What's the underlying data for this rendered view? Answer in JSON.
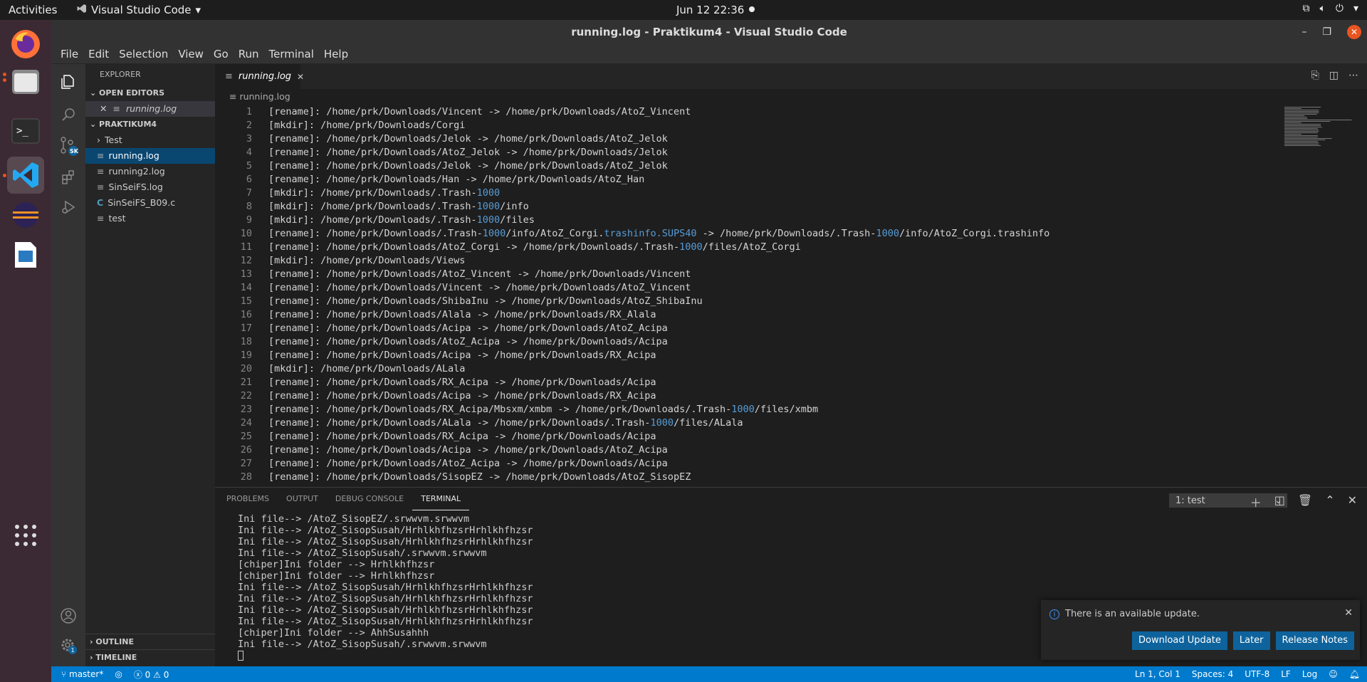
{
  "topbar": {
    "activities": "Activities",
    "app_menu": "Visual Studio Code",
    "clock": "Jun 12  22:36"
  },
  "window": {
    "title": "running.log - Praktikum4 - Visual Studio Code"
  },
  "menu": [
    "File",
    "Edit",
    "Selection",
    "View",
    "Go",
    "Run",
    "Terminal",
    "Help"
  ],
  "sidebar": {
    "title": "EXPLORER",
    "open_editors_label": "OPEN EDITORS",
    "open_editor_file": "running.log",
    "project_label": "PRAKTIKUM4",
    "files": [
      {
        "name": "Test",
        "type": "folder"
      },
      {
        "name": "running.log",
        "type": "log"
      },
      {
        "name": "running2.log",
        "type": "log"
      },
      {
        "name": "SinSeiFS.log",
        "type": "log"
      },
      {
        "name": "SinSeiFS_B09.c",
        "type": "c"
      },
      {
        "name": "test",
        "type": "file"
      }
    ],
    "outline_label": "OUTLINE",
    "timeline_label": "TIMELINE"
  },
  "editor": {
    "tab_label": "running.log",
    "breadcrumb": "running.log",
    "lines": [
      "[rename]: /home/prk/Downloads/Vincent -> /home/prk/Downloads/AtoZ_Vincent",
      "[mkdir]: /home/prk/Downloads/Corgi",
      "[rename]: /home/prk/Downloads/Jelok -> /home/prk/Downloads/AtoZ_Jelok",
      "[rename]: /home/prk/Downloads/AtoZ_Jelok -> /home/prk/Downloads/Jelok",
      "[rename]: /home/prk/Downloads/Jelok -> /home/prk/Downloads/AtoZ_Jelok",
      "[rename]: /home/prk/Downloads/Han -> /home/prk/Downloads/AtoZ_Han",
      "[mkdir]: /home/prk/Downloads/.Trash-1000",
      "[mkdir]: /home/prk/Downloads/.Trash-1000/info",
      "[mkdir]: /home/prk/Downloads/.Trash-1000/files",
      "[rename]: /home/prk/Downloads/.Trash-1000/info/AtoZ_Corgi.trashinfo.SUPS40 -> /home/prk/Downloads/.Trash-1000/info/AtoZ_Corgi.trashinfo",
      "[rename]: /home/prk/Downloads/AtoZ_Corgi -> /home/prk/Downloads/.Trash-1000/files/AtoZ_Corgi",
      "[mkdir]: /home/prk/Downloads/Views",
      "[rename]: /home/prk/Downloads/AtoZ_Vincent -> /home/prk/Downloads/Vincent",
      "[rename]: /home/prk/Downloads/Vincent -> /home/prk/Downloads/AtoZ_Vincent",
      "[rename]: /home/prk/Downloads/ShibaInu -> /home/prk/Downloads/AtoZ_ShibaInu",
      "[rename]: /home/prk/Downloads/Alala -> /home/prk/Downloads/RX_Alala",
      "[rename]: /home/prk/Downloads/Acipa -> /home/prk/Downloads/AtoZ_Acipa",
      "[rename]: /home/prk/Downloads/AtoZ_Acipa -> /home/prk/Downloads/Acipa",
      "[rename]: /home/prk/Downloads/Acipa -> /home/prk/Downloads/RX_Acipa",
      "[mkdir]: /home/prk/Downloads/ALala",
      "[rename]: /home/prk/Downloads/RX_Acipa -> /home/prk/Downloads/Acipa",
      "[rename]: /home/prk/Downloads/Acipa -> /home/prk/Downloads/RX_Acipa",
      "[rename]: /home/prk/Downloads/RX_Acipa/Mbsxm/xmbm -> /home/prk/Downloads/.Trash-1000/files/xmbm",
      "[rename]: /home/prk/Downloads/ALala -> /home/prk/Downloads/.Trash-1000/files/ALala",
      "[rename]: /home/prk/Downloads/RX_Acipa -> /home/prk/Downloads/Acipa",
      "[rename]: /home/prk/Downloads/Acipa -> /home/prk/Downloads/AtoZ_Acipa",
      "[rename]: /home/prk/Downloads/AtoZ_Acipa -> /home/prk/Downloads/Acipa",
      "[rename]: /home/prk/Downloads/SisopEZ -> /home/prk/Downloads/AtoZ_SisopEZ"
    ]
  },
  "panel": {
    "tabs": [
      "PROBLEMS",
      "OUTPUT",
      "DEBUG CONSOLE",
      "TERMINAL"
    ],
    "active_tab": "TERMINAL",
    "terminal_select": "1: test",
    "terminal_lines": [
      "Ini file--> /AtoZ_SisopEZ/.srwwvm.srwwvm",
      "Ini file--> /AtoZ_SisopSusah/HrhlkhfhzsrHrhlkhfhzsr",
      "Ini file--> /AtoZ_SisopSusah/HrhlkhfhzsrHrhlkhfhzsr",
      "Ini file--> /AtoZ_SisopSusah/.srwwvm.srwwvm",
      "[chiper]Ini folder --> Hrhlkhfhzsr",
      "[chiper]Ini folder --> Hrhlkhfhzsr",
      "Ini file--> /AtoZ_SisopSusah/HrhlkhfhzsrHrhlkhfhzsr",
      "Ini file--> /AtoZ_SisopSusah/HrhlkhfhzsrHrhlkhfhzsr",
      "Ini file--> /AtoZ_SisopSusah/HrhlkhfhzsrHrhlkhfhzsr",
      "Ini file--> /AtoZ_SisopSusah/HrhlkhfhzsrHrhlkhfhzsr",
      "[chiper]Ini folder --> AhhSusahhh",
      "Ini file--> /AtoZ_SisopSusah/.srwwvm.srwwvm"
    ]
  },
  "notification": {
    "message": "There is an available update.",
    "buttons": [
      "Download Update",
      "Later",
      "Release Notes"
    ]
  },
  "statusbar": {
    "branch": "master*",
    "problems": "0",
    "warnings": "0",
    "cursor": "Ln 1, Col 1",
    "spaces": "Spaces: 4",
    "encoding": "UTF-8",
    "eol": "LF",
    "language": "Log"
  },
  "colors": {
    "accent": "#007acc",
    "number_highlight": "#569cd6",
    "ubuntu_orange": "#e95420"
  }
}
